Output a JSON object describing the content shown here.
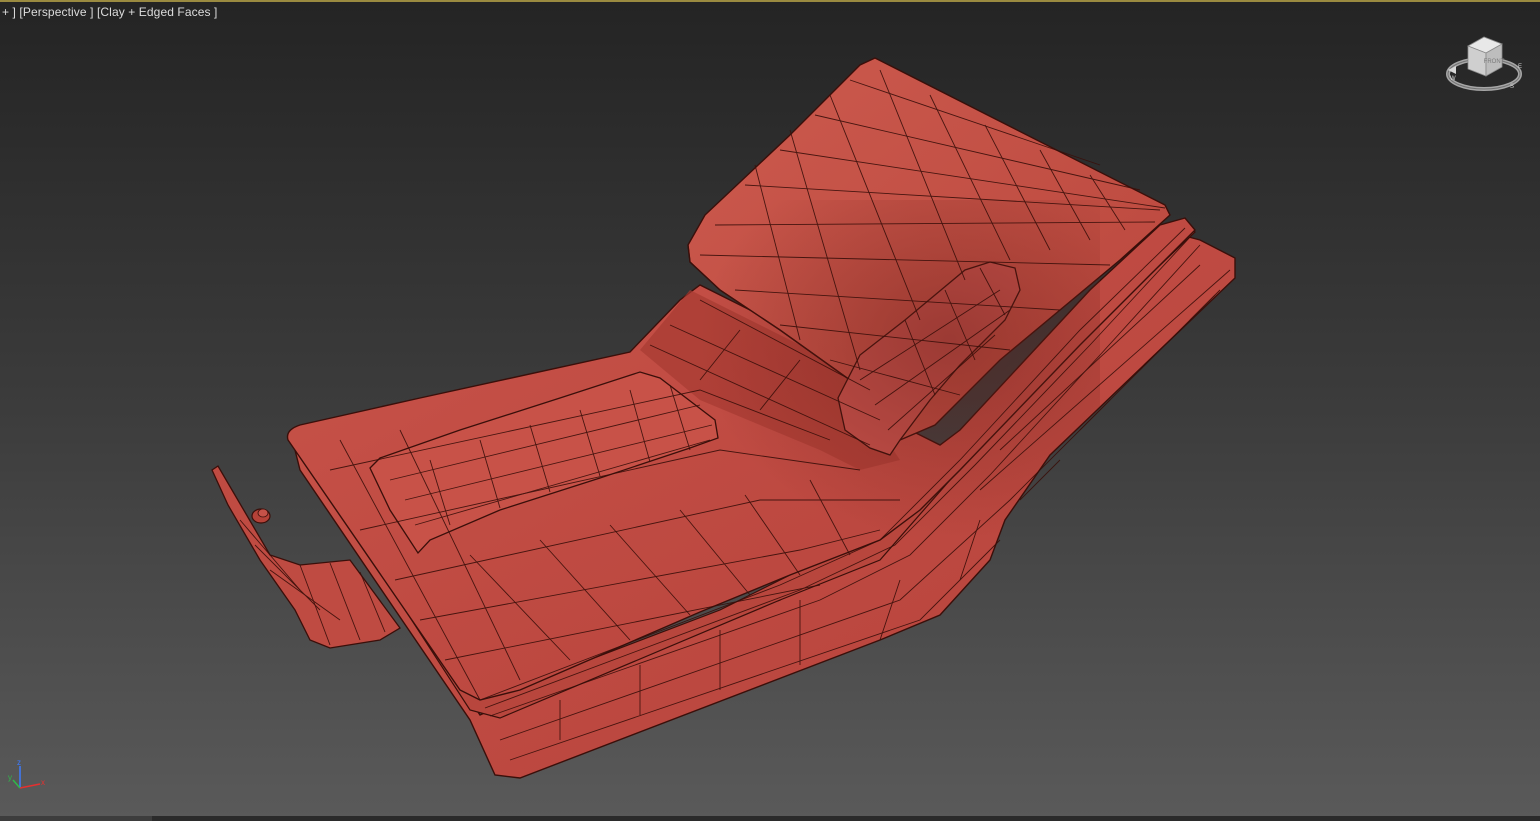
{
  "viewport": {
    "label": {
      "plus": "+",
      "view": "Perspective",
      "shading": "Clay + Edged Faces"
    },
    "model_color": "#c34b3c",
    "wire_color": "#3a0f0a",
    "viewcube": {
      "face": "FRONT",
      "compass": {
        "north": "N",
        "south": "S",
        "east": "E",
        "west": "W"
      }
    },
    "axis_gizmo": {
      "x": "x",
      "y": "y",
      "z": "z"
    }
  }
}
